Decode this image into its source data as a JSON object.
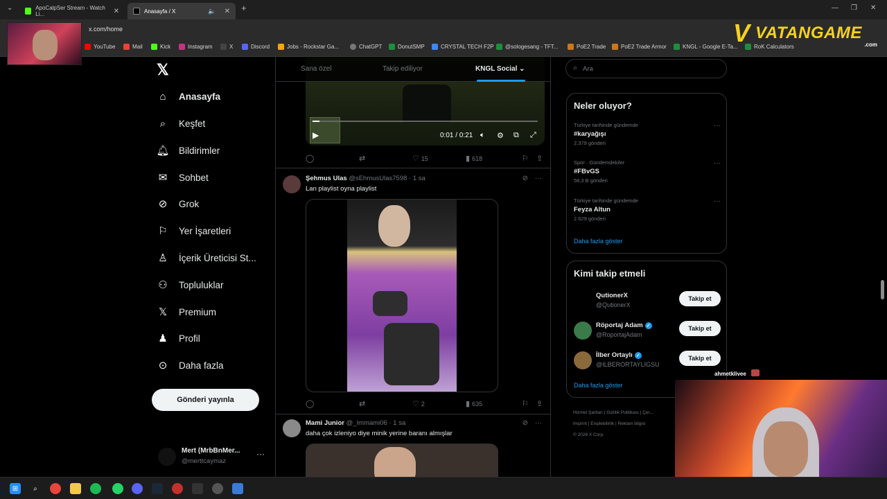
{
  "browser": {
    "tabs": [
      {
        "label": "ApoCalpSer Stream - Watch Li..."
      },
      {
        "label": "Anasayfa / X"
      }
    ],
    "url": "x.com/home",
    "bookmarks": [
      "YouTube",
      "Mail",
      "Kick",
      "Instagram",
      "X",
      "Discord",
      "Jobs - Rockstar Ga...",
      "ChatGPT",
      "DonutSMP",
      "CRYSTAL TECH F2P",
      "@sologesang - TFT...",
      "PoE2 Trade",
      "PoE2 Trade Armor",
      "KNGL - Google E-Ta...",
      "RoK Calculators"
    ]
  },
  "overlay": {
    "brand_main": "VATANGAME",
    "brand_suffix": ".com",
    "viewer_name": "ahmetklivee"
  },
  "nav": {
    "items": [
      {
        "label": "Anasayfa",
        "icon": "home-icon"
      },
      {
        "label": "Keşfet",
        "icon": "search-icon"
      },
      {
        "label": "Bildirimler",
        "icon": "bell-icon"
      },
      {
        "label": "Sohbet",
        "icon": "mail-icon"
      },
      {
        "label": "Grok",
        "icon": "grok-icon"
      },
      {
        "label": "Yer İşaretleri",
        "icon": "bookmark-icon"
      },
      {
        "label": "İçerik Üreticisi St...",
        "icon": "creator-icon"
      },
      {
        "label": "Topluluklar",
        "icon": "communities-icon"
      },
      {
        "label": "Premium",
        "icon": "x-logo-icon"
      },
      {
        "label": "Profil",
        "icon": "profile-icon"
      },
      {
        "label": "Daha fazla",
        "icon": "more-icon"
      }
    ],
    "post_button": "Gönderi yayınla",
    "account": {
      "name": "Mert (MrbBnMer...",
      "handle": "@merttcaymaz"
    }
  },
  "feed": {
    "tabs": [
      "Sana özel",
      "Takip ediliyor",
      "KNGL Social"
    ],
    "video1": {
      "time": "0:01 / 0:21",
      "replies": "",
      "retweets": "",
      "likes": "15",
      "views": "618",
      "progress": 0.03
    },
    "tweets": [
      {
        "name": "Şehmus Ulas",
        "handle": "@sEhmusUlas7598 · 1 sa",
        "text": "Lan playlist oyna playlist",
        "likes": "2",
        "views": "635"
      },
      {
        "name": "Mami Junior",
        "handle": "@_Immami06 · 1 sa",
        "text": "daha çok izleniyo diye minik yerine baranı almışlar"
      }
    ]
  },
  "sidebar": {
    "search_placeholder": "Ara",
    "trends_title": "Neler oluyor?",
    "trends": [
      {
        "context": "Türkiye tarihinde gündemde",
        "title": "#karyağışı",
        "count": "2.379 gönderi"
      },
      {
        "context": "Spor · Gündemdekiler",
        "title": "#FBvGS",
        "count": "58,3 B gönderi"
      },
      {
        "context": "Türkiye tarihinde gündemde",
        "title": "Feyza Altun",
        "count": "2.629 gönderi"
      }
    ],
    "trends_more": "Daha fazla göster",
    "who_title": "Kimi takip etmeli",
    "who": [
      {
        "name": "QutionerX",
        "handle": "@QutionerX",
        "verified": false,
        "button": "Takip et"
      },
      {
        "name": "Röportaj Adam",
        "handle": "@RoportajAdam",
        "verified": true,
        "button": "Takip et"
      },
      {
        "name": "İlber Ortaylı",
        "handle": "@ILBERORTAYLIGSU",
        "verified": true,
        "button": "Takip et"
      }
    ],
    "who_more": "Daha fazla göster",
    "footer": [
      "Hizmet Şartları",
      "Gizlilik Politikası",
      "Çer...",
      "Imprint",
      "Erişilebilirlik",
      "Reklam bilgisi",
      "© 2026 X Corp."
    ]
  },
  "colors": {
    "accent": "#1d9bf0",
    "background": "#000000",
    "text": "#e7e9ea",
    "muted": "#71767b",
    "brand_yellow": "#f4d21f"
  }
}
